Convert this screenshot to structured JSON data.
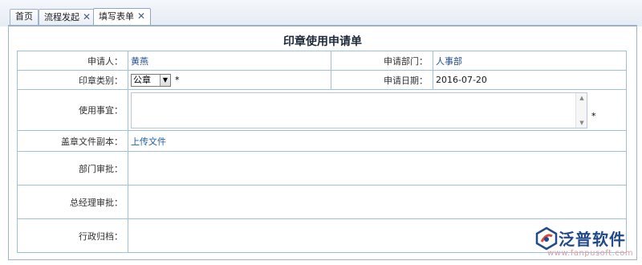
{
  "tabs": [
    {
      "label": "首页",
      "closable": false,
      "active": false
    },
    {
      "label": "流程发起",
      "closable": true,
      "active": false
    },
    {
      "label": "填写表单",
      "closable": true,
      "active": true
    }
  ],
  "close_glyph": "✕",
  "form": {
    "title": "印章使用申请单",
    "applicant_label": "申请人：",
    "applicant_value": "黄燕",
    "dept_label": "申请部门：",
    "dept_value": "人事部",
    "seal_type_label": "印章类别：",
    "seal_type_value": "公章",
    "required_mark": "*",
    "date_label": "申请日期：",
    "date_value": "2016-07-20",
    "purpose_label": "使用事宜：",
    "purpose_value": "",
    "copy_label": "盖章文件副本：",
    "copy_link": "上传文件",
    "dept_review_label": "部门审批：",
    "gm_review_label": "总经理审批：",
    "archive_label": "行政归档："
  },
  "watermark": {
    "brand": "泛普软件",
    "url": "www.fanpusoft.com"
  },
  "colors": {
    "border": "#9ec0de",
    "value_text": "#1f4e8c",
    "brand": "#234a8a"
  }
}
